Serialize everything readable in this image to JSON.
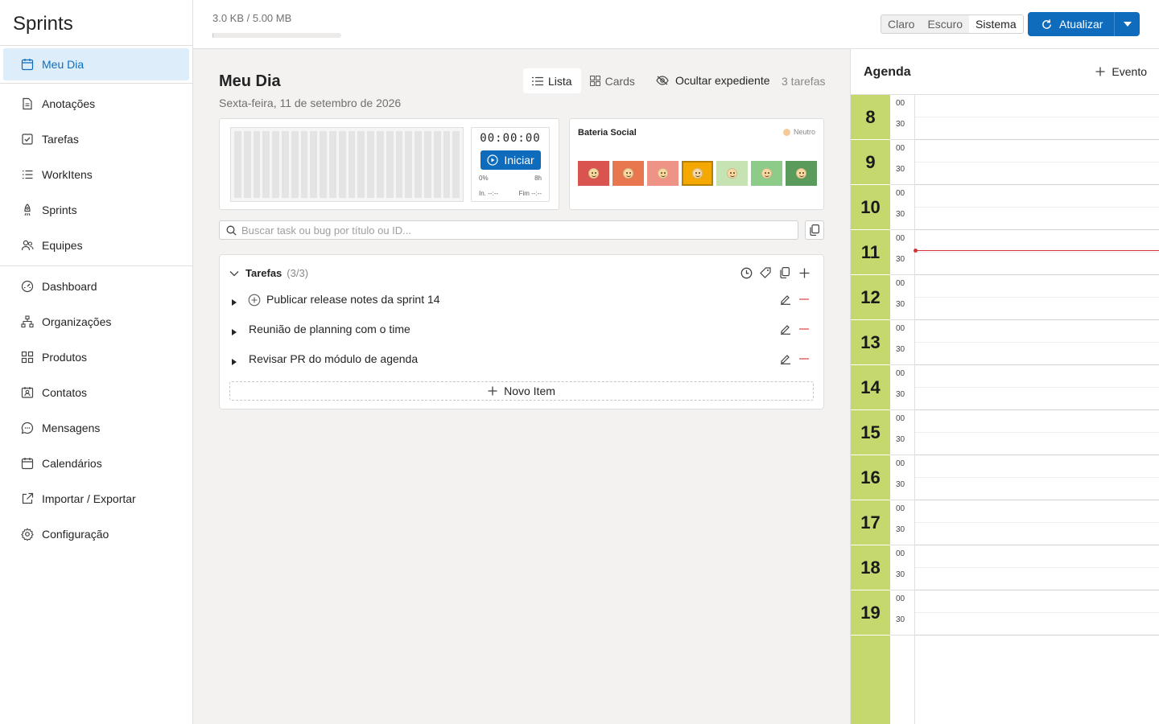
{
  "app": {
    "title": "Sprints"
  },
  "sidebar": {
    "groups": [
      [
        {
          "label": "Meu Dia",
          "icon": "calendar-day-icon",
          "active": true
        }
      ],
      [
        {
          "label": "Anotações",
          "icon": "document-icon"
        },
        {
          "label": "Tarefas",
          "icon": "checkbox-icon"
        },
        {
          "label": "WorkItens",
          "icon": "list-icon"
        },
        {
          "label": "Sprints",
          "icon": "rocket-icon"
        },
        {
          "label": "Equipes",
          "icon": "people-icon"
        }
      ],
      [
        {
          "label": "Dashboard",
          "icon": "gauge-icon"
        },
        {
          "label": "Organizações",
          "icon": "org-chart-icon"
        },
        {
          "label": "Produtos",
          "icon": "grid-icon"
        },
        {
          "label": "Contatos",
          "icon": "contact-card-icon"
        },
        {
          "label": "Mensagens",
          "icon": "chat-icon"
        },
        {
          "label": "Calendários",
          "icon": "calendar-icon"
        },
        {
          "label": "Importar / Exportar",
          "icon": "share-icon"
        },
        {
          "label": "Configuração",
          "icon": "gear-icon"
        }
      ]
    ]
  },
  "topbar": {
    "storage": {
      "text": "3.0 KB / 5.00 MB",
      "used_fraction": 0.0006
    },
    "theme": {
      "options": [
        "Claro",
        "Escuro",
        "Sistema"
      ],
      "selected": "Sistema"
    },
    "update_label": "Atualizar",
    "accent": "#0f6cbd"
  },
  "main": {
    "title": "Meu Dia",
    "date": "Sexta-feira, 11 de setembro de 2026",
    "view": {
      "list_label": "Lista",
      "cards_label": "Cards",
      "selected": "Lista"
    },
    "hide_label": "Ocultar expediente",
    "task_count": "3 tarefas",
    "timer": {
      "clock": "00:00:00",
      "start_label": "Iniciar",
      "progress": "0%",
      "hours": "8h",
      "in_label": "In. --:--",
      "end_label": "Fim --:--"
    },
    "battery": {
      "title": "Bateria Social",
      "state": "Neutro",
      "moods": [
        {
          "color": "#d9534f"
        },
        {
          "color": "#e8774f"
        },
        {
          "color": "#ee9385"
        },
        {
          "color": "#f5a800",
          "selected": true
        },
        {
          "color": "#c7e3b3"
        },
        {
          "color": "#8ccb88"
        },
        {
          "color": "#5a9a5a"
        }
      ]
    },
    "search": {
      "placeholder": "Buscar task ou bug por título ou ID..."
    },
    "tasks": {
      "title": "Tarefas",
      "count": "(3/3)",
      "items": [
        {
          "label": "Publicar release notes da sprint 14",
          "has_icon": true
        },
        {
          "label": "Reunião de planning com o time",
          "has_icon": false
        },
        {
          "label": "Revisar PR do módulo de agenda",
          "has_icon": false
        }
      ],
      "new_item_label": "Novo Item"
    }
  },
  "agenda": {
    "title": "Agenda",
    "add_label": "Evento",
    "hours": [
      "8",
      "9",
      "10",
      "11",
      "12",
      "13",
      "14",
      "15",
      "16",
      "17",
      "18",
      "19"
    ],
    "minutes": [
      "00",
      "30"
    ],
    "hour_color": "#c5d86d",
    "now_line_color": "#d13438"
  }
}
